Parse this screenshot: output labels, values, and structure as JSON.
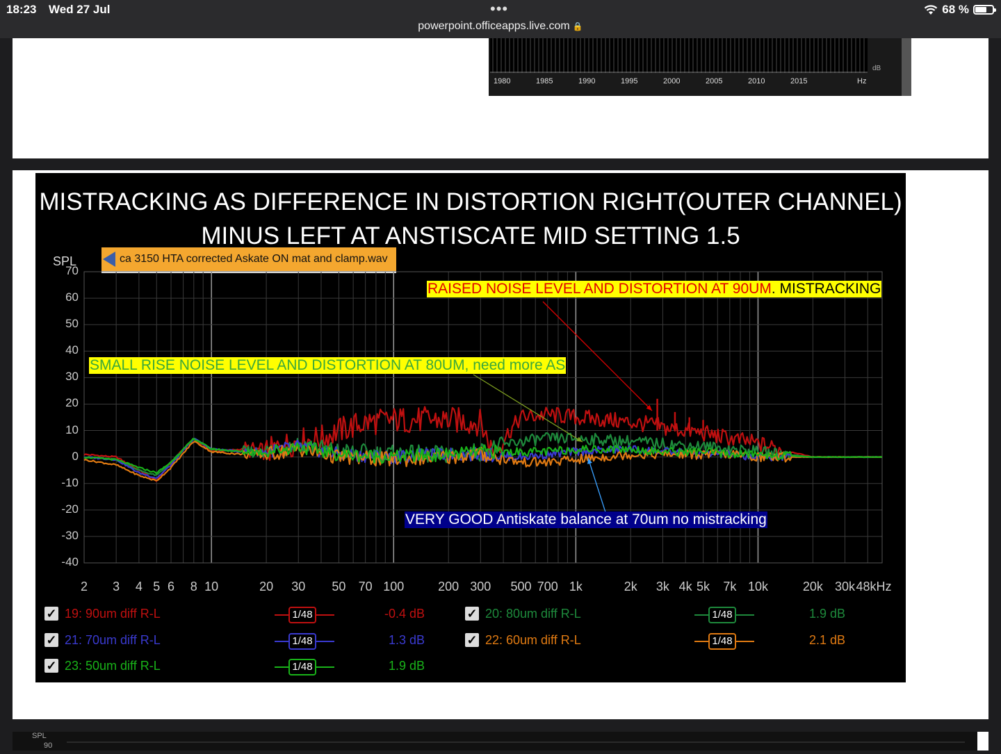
{
  "status": {
    "time": "18:23",
    "date": "Wed 27 Jul",
    "url": "powerpoint.officeapps.live.com",
    "battery": "68 %",
    "battery_level": 0.68
  },
  "mini_chart": {
    "years": [
      "1980",
      "1985",
      "1990",
      "1995",
      "2000",
      "2005",
      "2010",
      "2015"
    ],
    "unit": "Hz",
    "db_label": "dB"
  },
  "slide": {
    "title": "MISTRACKING AS DIFFERENCE IN DISTORTION RIGHT(OUTER CHANNEL) MINUS LEFT AT ANSTISCATE MID SETTING 1.5",
    "wav_file": "ca 3150 HTA corrected Askate ON  mat and clamp.wav",
    "annotations": {
      "raised_red": "RAISED NOISE LEVEL AND DISTORTION AT 90UM",
      "raised_black": ". MISTRACKING",
      "small_rise": "SMALL RISE  NOISE LEVEL AND DISTORTION AT 80UM, need  more AS",
      "very_good": "VERY GOOD Antiskate balance at 70um no mistracking"
    }
  },
  "chart_data": {
    "type": "line",
    "ylabel": "SPL",
    "ylim": [
      -40,
      70
    ],
    "yticks": [
      "70",
      "60",
      "50",
      "40",
      "30",
      "20",
      "10",
      "0",
      "-10",
      "-20",
      "-30",
      "-40"
    ],
    "xscale": "log",
    "xlim": [
      2,
      48000
    ],
    "xticks": [
      "2",
      "3",
      "4",
      "5",
      "6",
      "8",
      "10",
      "20",
      "30",
      "50",
      "70",
      "100",
      "200",
      "300",
      "500",
      "700",
      "1k",
      "2k",
      "3k",
      "4k",
      "5k",
      "7k",
      "10k",
      "20k",
      "30k",
      "48kHz"
    ],
    "grid": true,
    "legend_placement": "bottom",
    "series": [
      {
        "name": "19: 90um diff R-L",
        "smoothing": "1/48",
        "level": "-0.4 dB",
        "color": "#c01010",
        "x": [
          2,
          3,
          4,
          5,
          6,
          8,
          10,
          15,
          20,
          30,
          40,
          50,
          70,
          100,
          150,
          200,
          300,
          350,
          500,
          700,
          1000,
          1500,
          2000,
          2800,
          3000,
          4000,
          5000,
          7000,
          10000,
          15000,
          20000,
          48000
        ],
        "y": [
          1,
          0,
          -5,
          -9,
          -2,
          7,
          2,
          3,
          2,
          6,
          7,
          10,
          13,
          14,
          14,
          14,
          13,
          2,
          15,
          16,
          15,
          14,
          13,
          12,
          11,
          10,
          9,
          7,
          5,
          2,
          0,
          0
        ]
      },
      {
        "name": "20: 80um diff R-L",
        "smoothing": "1/48",
        "level": "1.9 dB",
        "color": "#1e8a3c",
        "x": [
          2,
          3,
          4,
          5,
          6,
          8,
          10,
          15,
          20,
          30,
          50,
          100,
          200,
          300,
          500,
          700,
          1000,
          2000,
          3000,
          5000,
          7000,
          10000,
          20000,
          48000
        ],
        "y": [
          0,
          -1,
          -5,
          -7,
          -2,
          7,
          3,
          2,
          2,
          5,
          2,
          1,
          1,
          2,
          6,
          7,
          7,
          6,
          5,
          4,
          3,
          2,
          0,
          0
        ]
      },
      {
        "name": "21: 70um diff R-L",
        "smoothing": "1/48",
        "level": "1.3 dB",
        "color": "#3a3ad0",
        "x": [
          2,
          3,
          4,
          5,
          6,
          8,
          10,
          15,
          20,
          30,
          50,
          100,
          200,
          300,
          500,
          700,
          1000,
          2000,
          3000,
          5000,
          7000,
          10000,
          20000,
          48000
        ],
        "y": [
          0,
          -1,
          -6,
          -8,
          -3,
          7,
          3,
          2,
          2,
          4,
          1,
          0,
          1,
          1,
          0,
          1,
          2,
          3,
          2,
          1,
          1,
          0,
          0,
          0
        ]
      },
      {
        "name": "22: 60um diff R-L",
        "smoothing": "1/48",
        "level": "2.1 dB",
        "color": "#e07a12",
        "x": [
          2,
          3,
          4,
          5,
          6,
          8,
          10,
          15,
          20,
          30,
          50,
          100,
          200,
          300,
          500,
          700,
          1000,
          2000,
          3000,
          5000,
          7000,
          10000,
          20000,
          48000
        ],
        "y": [
          -1,
          -3,
          -7,
          -9,
          -4,
          6,
          2,
          1,
          1,
          3,
          0,
          -1,
          0,
          1,
          -2,
          -2,
          -1,
          1,
          1,
          1,
          1,
          0,
          0,
          0
        ]
      },
      {
        "name": "23: 50um diff R-L",
        "smoothing": "1/48",
        "level": "1.9 dB",
        "color": "#19b319",
        "x": [
          2,
          3,
          4,
          5,
          6,
          8,
          10,
          15,
          20,
          30,
          50,
          100,
          200,
          300,
          500,
          700,
          1000,
          2000,
          3000,
          5000,
          7000,
          10000,
          20000,
          48000
        ],
        "y": [
          0,
          -1,
          -4,
          -6,
          -2,
          7,
          3,
          2,
          2,
          4,
          1,
          0,
          1,
          2,
          2,
          2,
          3,
          3,
          2,
          2,
          1,
          1,
          0,
          0
        ]
      }
    ]
  }
}
